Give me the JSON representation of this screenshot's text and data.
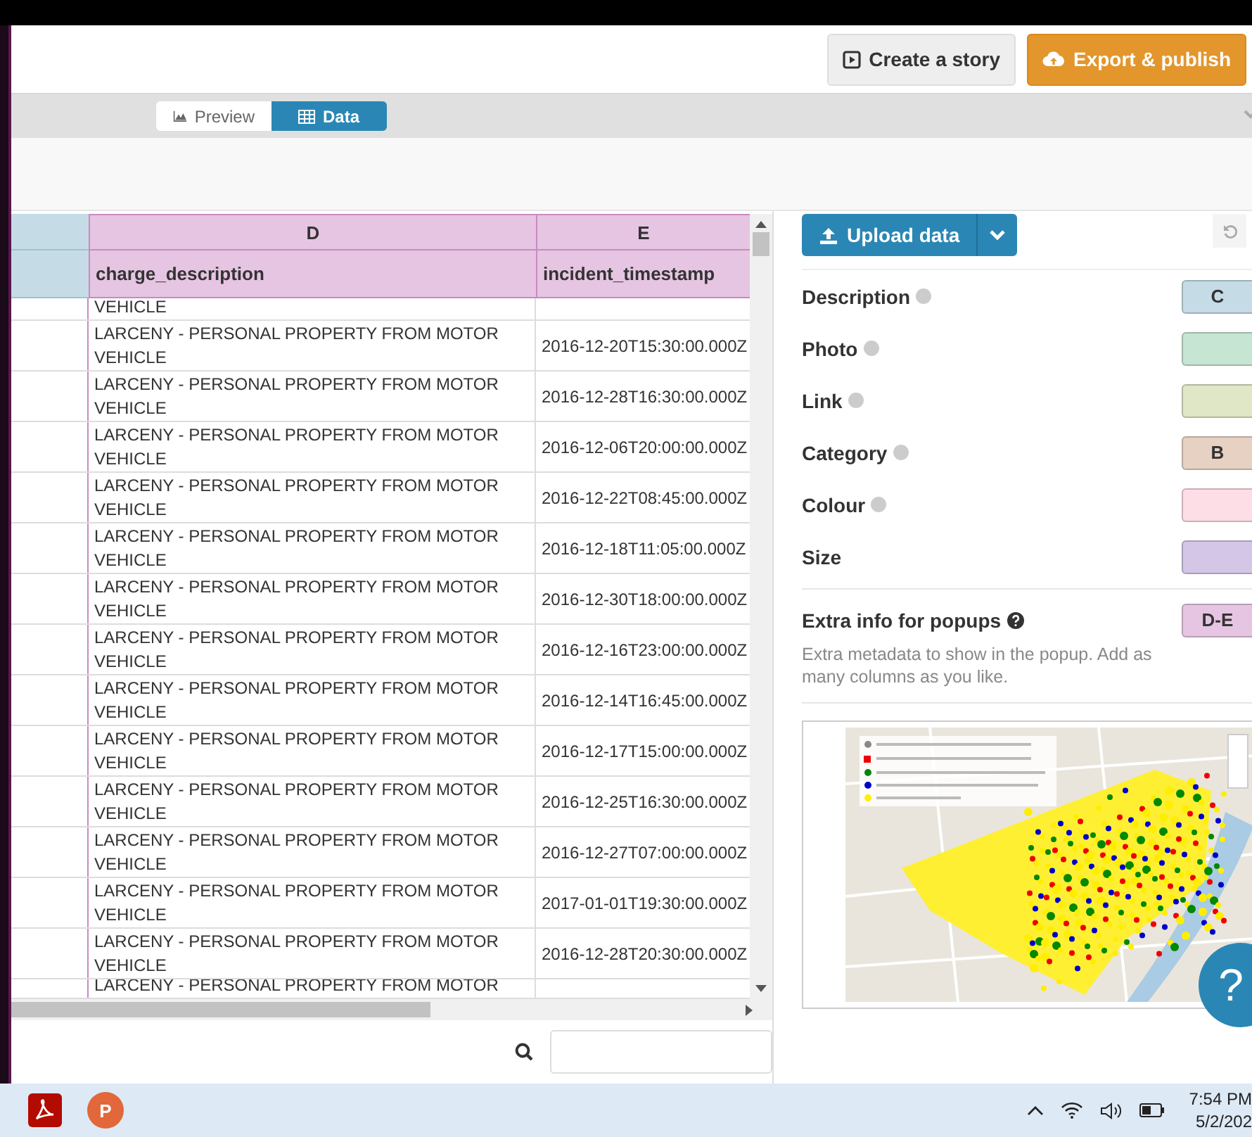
{
  "header": {
    "buttons": [
      {
        "kind": "story",
        "label": "Create a story"
      },
      {
        "kind": "export",
        "label": "Export & publish"
      }
    ]
  },
  "view_tabs": [
    {
      "kind": "chart",
      "label": "Preview",
      "selected": false
    },
    {
      "kind": "table",
      "label": "Data",
      "selected": true
    }
  ],
  "table": {
    "columns": [
      {
        "letter": "D",
        "name": "charge_description"
      },
      {
        "letter": "E",
        "name": "incident_timestamp"
      }
    ],
    "rows": [
      {
        "kind": "partial",
        "description": "VEHICLE"
      },
      {
        "kind": "full",
        "description": "LARCENY - PERSONAL PROPERTY FROM MOTOR VEHICLE",
        "timestamp": "2016-12-20T15:30:00.000Z"
      },
      {
        "kind": "full",
        "description": "LARCENY - PERSONAL PROPERTY FROM MOTOR VEHICLE",
        "timestamp": "2016-12-28T16:30:00.000Z"
      },
      {
        "kind": "full",
        "description": "LARCENY - PERSONAL PROPERTY FROM MOTOR VEHICLE",
        "timestamp": "2016-12-06T20:00:00.000Z"
      },
      {
        "kind": "full",
        "description": "LARCENY - PERSONAL PROPERTY FROM MOTOR VEHICLE",
        "timestamp": "2016-12-22T08:45:00.000Z"
      },
      {
        "kind": "full",
        "description": "LARCENY - PERSONAL PROPERTY FROM MOTOR VEHICLE",
        "timestamp": "2016-12-18T11:05:00.000Z"
      },
      {
        "kind": "full",
        "description": "LARCENY - PERSONAL PROPERTY FROM MOTOR VEHICLE",
        "timestamp": "2016-12-30T18:00:00.000Z"
      },
      {
        "kind": "full",
        "description": "LARCENY - PERSONAL PROPERTY FROM MOTOR VEHICLE",
        "timestamp": "2016-12-16T23:00:00.000Z"
      },
      {
        "kind": "full",
        "description": "LARCENY - PERSONAL PROPERTY FROM MOTOR VEHICLE",
        "timestamp": "2016-12-14T16:45:00.000Z"
      },
      {
        "kind": "full",
        "description": "LARCENY - PERSONAL PROPERTY FROM MOTOR VEHICLE",
        "timestamp": "2016-12-17T15:00:00.000Z"
      },
      {
        "kind": "full",
        "description": "LARCENY - PERSONAL PROPERTY FROM MOTOR VEHICLE",
        "timestamp": "2016-12-25T16:30:00.000Z"
      },
      {
        "kind": "full",
        "description": "LARCENY - PERSONAL PROPERTY FROM MOTOR VEHICLE",
        "timestamp": "2016-12-27T07:00:00.000Z"
      },
      {
        "kind": "full",
        "description": "LARCENY - PERSONAL PROPERTY FROM MOTOR VEHICLE",
        "timestamp": "2017-01-01T19:30:00.000Z"
      },
      {
        "kind": "full",
        "description": "LARCENY - PERSONAL PROPERTY FROM MOTOR VEHICLE",
        "timestamp": "2016-12-28T20:30:00.000Z"
      },
      {
        "kind": "partial",
        "description": "LARCENY - PERSONAL PROPERTY FROM MOTOR"
      }
    ]
  },
  "upload": {
    "label": "Upload data"
  },
  "fields": [
    {
      "label": "Description",
      "help": true,
      "strong": false,
      "column": "C",
      "color": "#c5dce6"
    },
    {
      "label": "Photo",
      "help": true,
      "strong": false,
      "color": "#c6e5d3"
    },
    {
      "label": "Link",
      "help": true,
      "strong": false,
      "color": "#dfe7c6"
    },
    {
      "label": "Category",
      "help": true,
      "strong": false,
      "column": "B",
      "color": "#e6d1c3"
    },
    {
      "label": "Colour",
      "help": true,
      "strong": false,
      "color": "#fddde6"
    },
    {
      "label": "Size",
      "help": false,
      "color": "#d3c6e6"
    },
    {
      "label": "Extra info for popups",
      "help": true,
      "strong": true,
      "column": "D-E",
      "color": "#e6c5e2",
      "note": "Extra metadata to show in the popup. Add as many columns as you like."
    }
  ],
  "help_button": {
    "label": "?"
  },
  "taskbar": {
    "apps": [
      {
        "kind": "pdf"
      },
      {
        "kind": "slides",
        "letter": "P"
      }
    ],
    "time": "7:54 PM",
    "date": "5/2/202"
  }
}
